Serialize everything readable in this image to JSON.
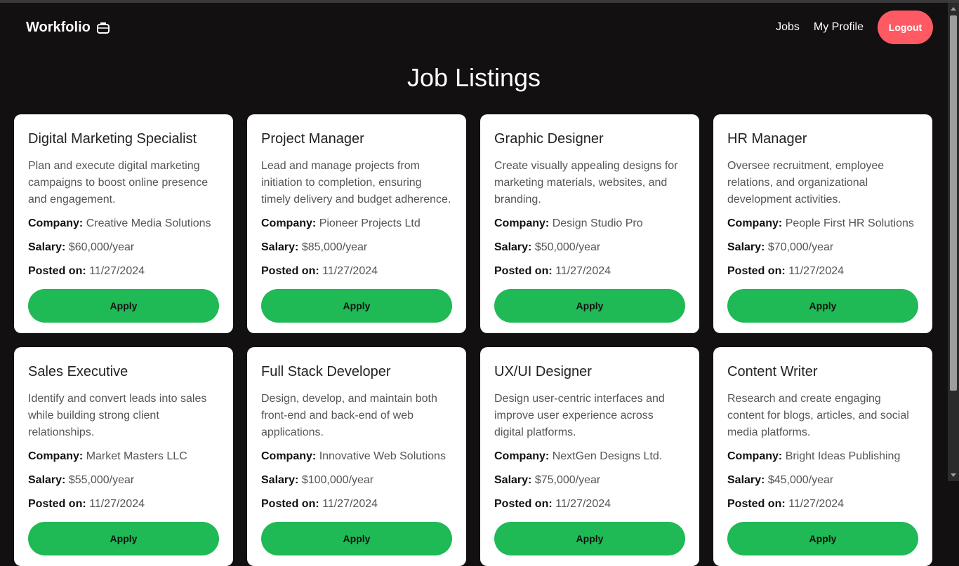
{
  "nav": {
    "brand": "Workfolio",
    "brand_icon": "briefcase-icon",
    "links": [
      "Jobs",
      "My Profile"
    ],
    "logout_label": "Logout"
  },
  "page_title": "Job Listings",
  "labels": {
    "company": "Company:",
    "salary": "Salary:",
    "posted": "Posted on:",
    "apply": "Apply"
  },
  "jobs": [
    {
      "title": "Digital Marketing Specialist",
      "description": "Plan and execute digital marketing campaigns to boost online presence and engagement.",
      "company": "Creative Media Solutions",
      "salary": "$60,000/year",
      "posted": "11/27/2024"
    },
    {
      "title": "Project Manager",
      "description": "Lead and manage projects from initiation to completion, ensuring timely delivery and budget adherence.",
      "company": "Pioneer Projects Ltd",
      "salary": "$85,000/year",
      "posted": "11/27/2024"
    },
    {
      "title": "Graphic Designer",
      "description": "Create visually appealing designs for marketing materials, websites, and branding.",
      "company": "Design Studio Pro",
      "salary": "$50,000/year",
      "posted": "11/27/2024"
    },
    {
      "title": "HR Manager",
      "description": "Oversee recruitment, employee relations, and organizational development activities.",
      "company": "People First HR Solutions",
      "salary": "$70,000/year",
      "posted": "11/27/2024"
    },
    {
      "title": "Sales Executive",
      "description": "Identify and convert leads into sales while building strong client relationships.",
      "company": "Market Masters LLC",
      "salary": "$55,000/year",
      "posted": "11/27/2024"
    },
    {
      "title": "Full Stack Developer",
      "description": "Design, develop, and maintain both front-end and back-end of web applications.",
      "company": "Innovative Web Solutions",
      "salary": "$100,000/year",
      "posted": "11/27/2024"
    },
    {
      "title": "UX/UI Designer",
      "description": "Design user-centric interfaces and improve user experience across digital platforms.",
      "company": "NextGen Designs Ltd.",
      "salary": "$75,000/year",
      "posted": "11/27/2024"
    },
    {
      "title": "Content Writer",
      "description": "Research and create engaging content for blogs, articles, and social media platforms.",
      "company": "Bright Ideas Publishing",
      "salary": "$45,000/year",
      "posted": "11/27/2024"
    }
  ],
  "colors": {
    "background": "#121010",
    "card": "#ffffff",
    "apply": "#1fb955",
    "logout": "#ff5a64"
  }
}
